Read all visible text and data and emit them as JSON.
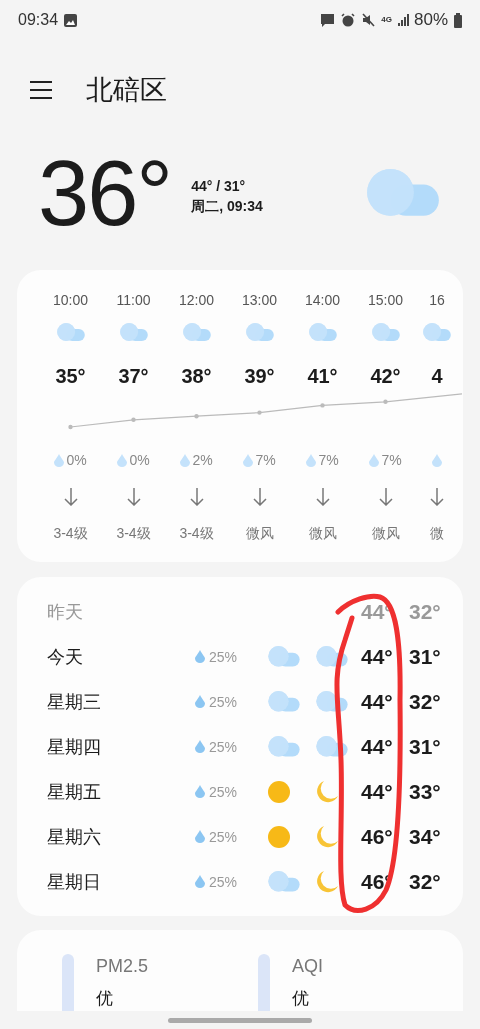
{
  "status_bar": {
    "time": "09:34",
    "network": "4G",
    "battery": "80%"
  },
  "header": {
    "title": "北碚区"
  },
  "current": {
    "temperature": "36°",
    "icon": {
      "kind": "cloudy"
    },
    "high_low": "44° / 31°",
    "date_time": "周二, 09:34"
  },
  "hourly": [
    {
      "time": "10:00",
      "icon": {
        "kind": "cloudy"
      },
      "temp": "35°",
      "precip": "0%",
      "wind": "3-4级"
    },
    {
      "time": "11:00",
      "icon": {
        "kind": "cloudy"
      },
      "temp": "37°",
      "precip": "0%",
      "wind": "3-4级"
    },
    {
      "time": "12:00",
      "icon": {
        "kind": "cloudy"
      },
      "temp": "38°",
      "precip": "2%",
      "wind": "3-4级"
    },
    {
      "time": "13:00",
      "icon": {
        "kind": "cloudy"
      },
      "temp": "39°",
      "precip": "7%",
      "wind": "微风"
    },
    {
      "time": "14:00",
      "icon": {
        "kind": "cloudy"
      },
      "temp": "41°",
      "precip": "7%",
      "wind": "微风"
    },
    {
      "time": "15:00",
      "icon": {
        "kind": "cloudy"
      },
      "temp": "42°",
      "precip": "7%",
      "wind": "微风"
    },
    {
      "time": "16",
      "icon": {
        "kind": "cloudy"
      },
      "temp": "4",
      "wind": "微"
    }
  ],
  "daily": [
    {
      "day": "昨天",
      "past": true,
      "high": "44°",
      "low": "32°"
    },
    {
      "day": "今天",
      "past": false,
      "precip": "25%",
      "day_icon": {
        "kind": "cloudy"
      },
      "night_icon": {
        "kind": "cloudy"
      },
      "high": "44°",
      "low": "31°"
    },
    {
      "day": "星期三",
      "past": false,
      "precip": "25%",
      "day_icon": {
        "kind": "cloudy"
      },
      "night_icon": {
        "kind": "cloudy"
      },
      "high": "44°",
      "low": "32°"
    },
    {
      "day": "星期四",
      "past": false,
      "precip": "25%",
      "day_icon": {
        "kind": "cloudy"
      },
      "night_icon": {
        "kind": "cloudy"
      },
      "high": "44°",
      "low": "31°"
    },
    {
      "day": "星期五",
      "past": false,
      "precip": "25%",
      "day_icon": {
        "kind": "sunny"
      },
      "night_icon": {
        "kind": "clear"
      },
      "high": "44°",
      "low": "33°"
    },
    {
      "day": "星期六",
      "past": false,
      "precip": "25%",
      "day_icon": {
        "kind": "sunny"
      },
      "night_icon": {
        "kind": "clear"
      },
      "high": "46°",
      "low": "34°"
    },
    {
      "day": "星期日",
      "past": false,
      "precip": "25%",
      "day_icon": {
        "kind": "cloudy"
      },
      "night_icon": {
        "kind": "clear"
      },
      "high": "46°",
      "low": "32°"
    }
  ],
  "air_quality": [
    {
      "label": "PM2.5",
      "value": "优"
    },
    {
      "label": "AQI",
      "value": "优"
    }
  ]
}
